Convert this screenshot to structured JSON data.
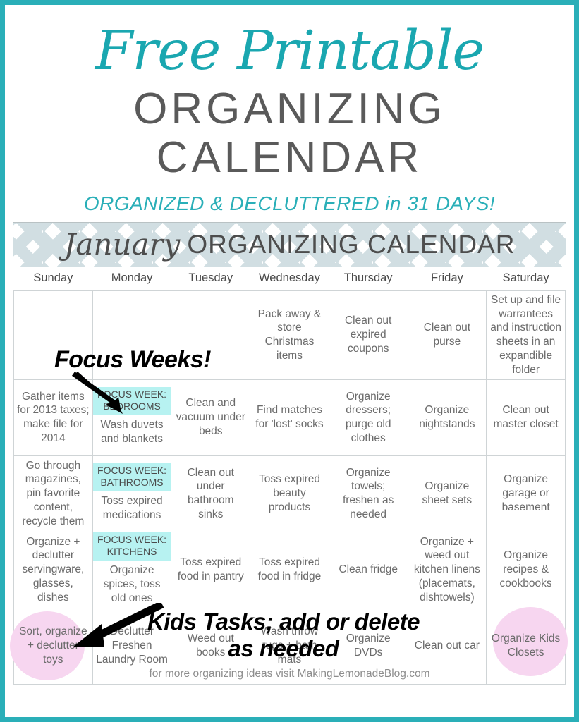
{
  "header": {
    "script_title": "Free Printable",
    "main_title_line1": "ORGANIZING",
    "main_title_line2": "CALENDAR",
    "subtitle": "ORGANIZED & DECLUTTERED in 31 DAYS!"
  },
  "banner": {
    "month": "January",
    "title": "ORGANIZING CALENDAR"
  },
  "annotations": {
    "focus_weeks": "Focus Weeks!",
    "kids_tasks": "Kids Tasks; add or delete as needed"
  },
  "footer": {
    "note": "for more organizing ideas visit MakingLemonadeBlog.com"
  },
  "colors": {
    "frame": "#2aafb8",
    "teal_text": "#1aa7b0",
    "subtitle_teal": "#2aafb8",
    "heading_gray": "#5a5a5a",
    "chevron_blue": "#cfdde1",
    "focus_highlight": "#b7f2f1",
    "kids_circle_pink": "#f7d6f0",
    "cell_text": "#6b6b6b",
    "grid_line": "#cfd4d6"
  },
  "weekdays": [
    "Sunday",
    "Monday",
    "Tuesday",
    "Wednesday",
    "Thursday",
    "Friday",
    "Saturday"
  ],
  "weeks": [
    {
      "cells": [
        {
          "text": ""
        },
        {
          "text": ""
        },
        {
          "text": ""
        },
        {
          "text": "Pack away & store Christmas items"
        },
        {
          "text": "Clean out expired coupons"
        },
        {
          "text": "Clean out purse"
        },
        {
          "text": "Set up and file warrantees and instruction sheets in an expandible folder"
        }
      ]
    },
    {
      "cells": [
        {
          "text": "Gather items for 2013 taxes; make file for 2014"
        },
        {
          "focus": "FOCUS WEEK: BEDROOMS",
          "text": "Wash duvets and blankets"
        },
        {
          "text": "Clean and vacuum under beds"
        },
        {
          "text": "Find matches for 'lost' socks"
        },
        {
          "text": "Organize dressers; purge old clothes"
        },
        {
          "text": "Organize nightstands"
        },
        {
          "text": "Clean out master closet"
        }
      ]
    },
    {
      "cells": [
        {
          "text": "Go through magazines, pin favorite content, recycle them"
        },
        {
          "focus": "FOCUS WEEK: BATHROOMS",
          "text": "Toss expired medications"
        },
        {
          "text": "Clean out under bathroom sinks"
        },
        {
          "text": "Toss expired beauty products"
        },
        {
          "text": "Organize towels; freshen as needed"
        },
        {
          "text": "Organize sheet sets"
        },
        {
          "text": "Organize garage or basement"
        }
      ]
    },
    {
      "cells": [
        {
          "text": "Organize + declutter servingware, glasses, dishes"
        },
        {
          "focus": "FOCUS WEEK: KITCHENS",
          "text": "Organize spices, toss old ones"
        },
        {
          "text": "Toss expired food in pantry"
        },
        {
          "text": "Toss expired food in fridge"
        },
        {
          "text": "Clean fridge"
        },
        {
          "text": "Organize + weed out kitchen linens (placemats, dishtowels)"
        },
        {
          "text": "Organize recipes & cookbooks"
        }
      ]
    },
    {
      "cells": [
        {
          "text": "Sort, organize + declutter toys",
          "kids": "left"
        },
        {
          "text": "Declutter Freshen Laundry Room"
        },
        {
          "text": "Weed out books"
        },
        {
          "text": "Wash throw rugs + bath mats"
        },
        {
          "text": "Organize DVDs"
        },
        {
          "text": "Clean out car"
        },
        {
          "text": "Organize Kids Closets",
          "kids": "right"
        }
      ]
    }
  ]
}
